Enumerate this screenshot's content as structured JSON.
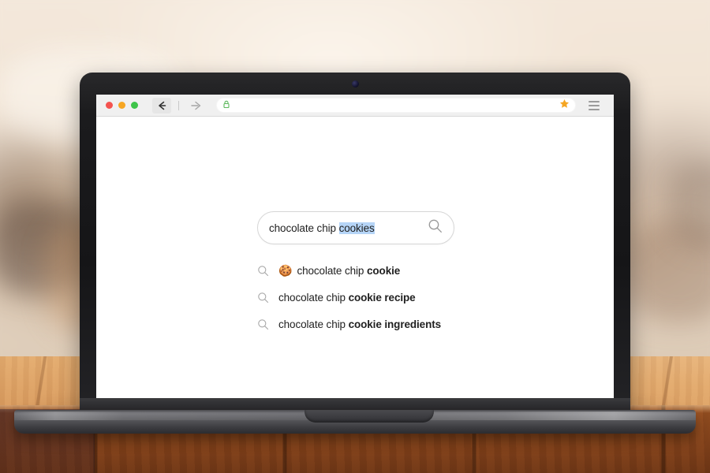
{
  "scene": {
    "device": "laptop",
    "surface": "wooden-table",
    "background": "blurred-kitchen-interior"
  },
  "browser": {
    "window_controls": [
      {
        "name": "close",
        "color": "#f4534f"
      },
      {
        "name": "minimize",
        "color": "#f6a623"
      },
      {
        "name": "maximize",
        "color": "#3ec44a"
      }
    ],
    "back_label": "Back",
    "forward_label": "Forward",
    "back_enabled": true,
    "forward_enabled": false,
    "urlbar": {
      "value": "",
      "placeholder": "",
      "lock_state": "secure",
      "lock_color": "#5cb85c",
      "bookmark_state": "bookmarked",
      "bookmark_color": "#f5a623"
    },
    "menu_label": "Menu"
  },
  "page": {
    "search": {
      "query_prefix": "chocolate chip ",
      "query_selected": "cookies",
      "full_query": "chocolate chip cookies",
      "placeholder": "Search",
      "selection_color": "#b6d5f7",
      "submit_label": "Search"
    },
    "suggestions": [
      {
        "prefix": "chocolate chip ",
        "bold": "cookie",
        "emoji": "🍪",
        "has_emoji": true
      },
      {
        "prefix": "chocolate chip ",
        "bold": "cookie recipe",
        "emoji": "",
        "has_emoji": false
      },
      {
        "prefix": "chocolate chip ",
        "bold": "cookie ingredients",
        "emoji": "",
        "has_emoji": false
      }
    ]
  }
}
